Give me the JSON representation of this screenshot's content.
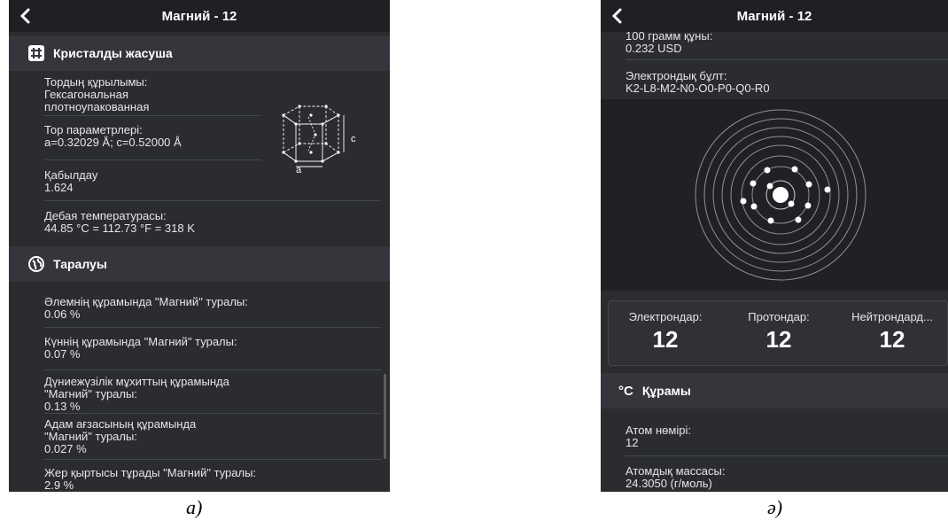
{
  "left": {
    "title": "Магний - 12",
    "crystal_section": {
      "title": "Кристалды жасуша",
      "icon": "grid-icon"
    },
    "crystal_items": [
      {
        "label": "Тордың құрылымы:",
        "value": "Гексагональная\nплотноупакованная"
      },
      {
        "label": "Тор параметрлері:",
        "value": "a=0.32029 Å; c=0.52000 Å"
      },
      {
        "label": "Қабылдау",
        "value": "1.624"
      },
      {
        "label": "Дебая температурасы:",
        "value": "44.85 °C = 112.73 °F = 318 K"
      }
    ],
    "lattice_labels": {
      "c": "c",
      "a": "a"
    },
    "distribution_section": {
      "title": "Таралуы",
      "icon": "globe-icon"
    },
    "distribution_items": [
      {
        "label": "Әлемнің құрамында \"Магний\" туралы:",
        "value": "0.06 %"
      },
      {
        "label": "Күннің құрамында \"Магний\" туралы:",
        "value": "0.07 %"
      },
      {
        "label": "Дүниежүзілік мұхиттың құрамында\n\"Магний\" туралы:",
        "value": "0.13 %"
      },
      {
        "label": "Адам ағзасының құрамында\n\"Магний\" туралы:",
        "value": "0.027 %"
      },
      {
        "label": "Жер қыртысы тұрады \"Магний\" туралы:",
        "value": "2.9 %"
      }
    ],
    "caption": "а)"
  },
  "right": {
    "title": "Магний - 12",
    "top_items": [
      {
        "label": "100 грамм құны:",
        "value": "0.232 USD"
      },
      {
        "label": "Электрондық бұлт:",
        "value": "K2-L8-M2-N0-O0-P0-Q0-R0"
      }
    ],
    "stats": [
      {
        "label": "Электрондар:",
        "value": "12"
      },
      {
        "label": "Протондар:",
        "value": "12"
      },
      {
        "label": "Нейтрондард...",
        "value": "12"
      }
    ],
    "composition_section": {
      "title": "Құрамы",
      "icon": "celsius-icon",
      "icon_text": "°C"
    },
    "composition_items": [
      {
        "label": "Атом нөмірі:",
        "value": "12"
      },
      {
        "label": "Атомдық массасы:",
        "value": "24.3050 (г/моль)"
      }
    ],
    "caption": "ә)"
  }
}
